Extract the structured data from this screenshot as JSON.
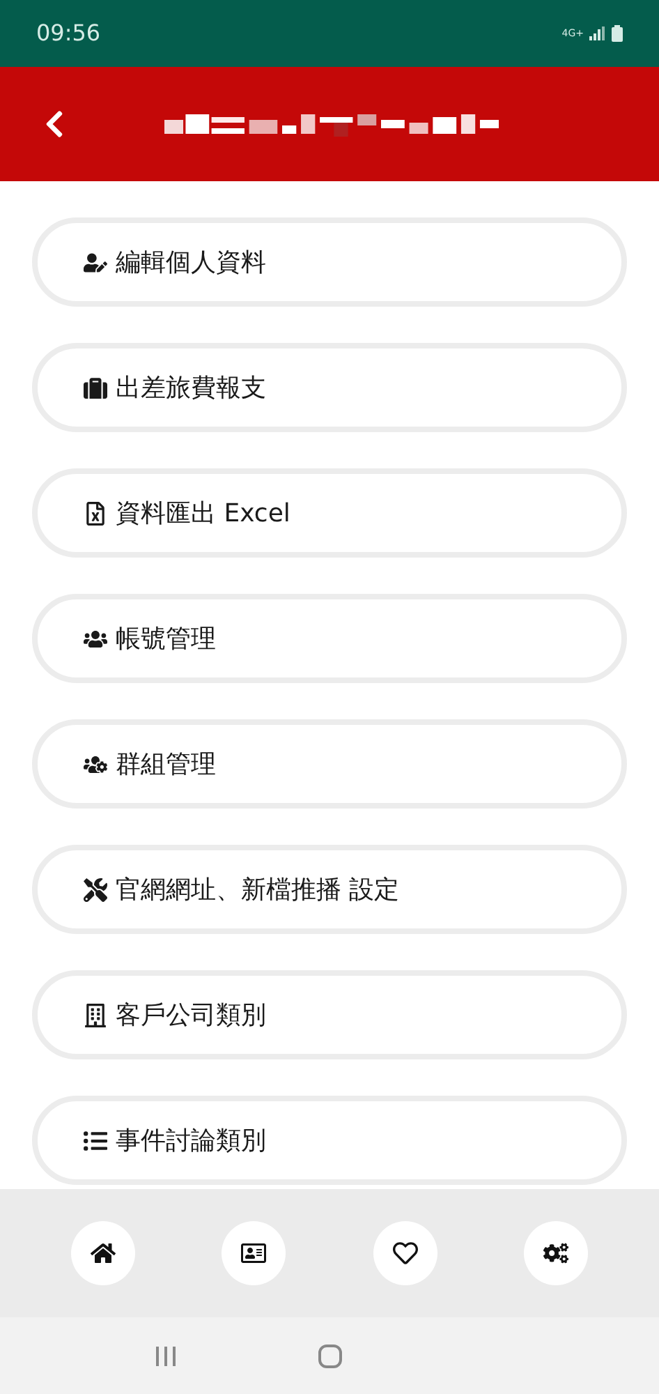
{
  "status_bar": {
    "time": "09:56",
    "network": "4G+"
  },
  "menu": [
    {
      "label": "編輯個人資料"
    },
    {
      "label": "出差旅費報支"
    },
    {
      "label": "資料匯出 Excel"
    },
    {
      "label": "帳號管理"
    },
    {
      "label": "群組管理"
    },
    {
      "label": "官網網址、新檔推播 設定"
    },
    {
      "label": "客戶公司類別"
    },
    {
      "label": "事件討論類別"
    }
  ]
}
